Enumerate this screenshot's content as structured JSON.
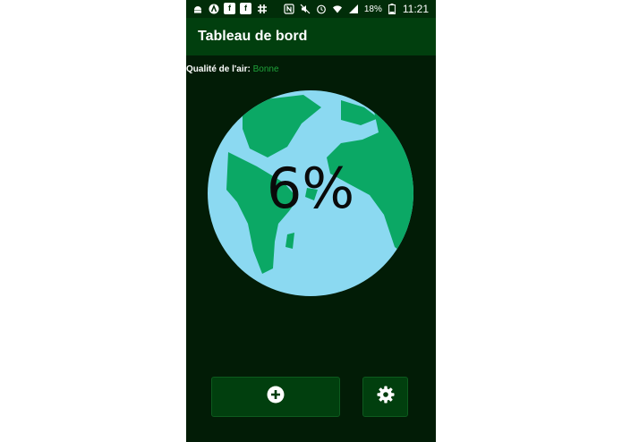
{
  "status_bar": {
    "icons": [
      "android-icon",
      "arch-icon",
      "facebook-icon",
      "facebook-icon",
      "slack-icon",
      "nfc-icon",
      "mute-icon",
      "alarm-icon",
      "wifi-icon",
      "signal-icon"
    ],
    "battery": "18%",
    "time": "11:21"
  },
  "app_bar": {
    "title": "Tableau de bord"
  },
  "air_quality": {
    "label": "Qualité de l'air:",
    "value": "Bonne",
    "value_color": "#1fa23a"
  },
  "gauge": {
    "value_text": "6%",
    "value": 6,
    "icon": "earth-globe-icon",
    "ocean_color": "#8bd9f1",
    "land_color": "#0ba865"
  },
  "actions": {
    "add_icon": "plus-circle-icon",
    "settings_icon": "gear-icon"
  },
  "theme": {
    "background": "#021c06",
    "app_bar": "#013f0e",
    "status_bar": "#012d09"
  }
}
